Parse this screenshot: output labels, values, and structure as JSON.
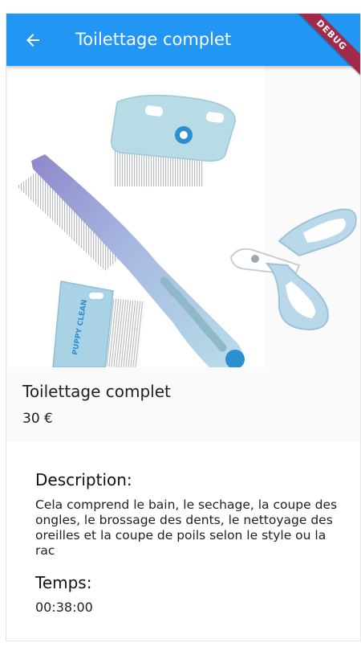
{
  "appbar": {
    "title": "Toilettage complet",
    "back_icon": "arrow-left-icon",
    "debug_label": "DEBUG",
    "color": "#2196f3",
    "debug_color": "#a3284a"
  },
  "product": {
    "name": "Toilettage complet",
    "price": "30 €",
    "image_brand_text": "PUPPY CLEAN"
  },
  "details": {
    "description_label": "Description:",
    "description_text": "Cela comprend le bain, le sechage, la coupe des ongles, le brossage des dents, le nettoyage des oreilles et la coupe de poils selon le style ou la rac",
    "time_label": "Temps:",
    "time_value": "00:38:00"
  }
}
